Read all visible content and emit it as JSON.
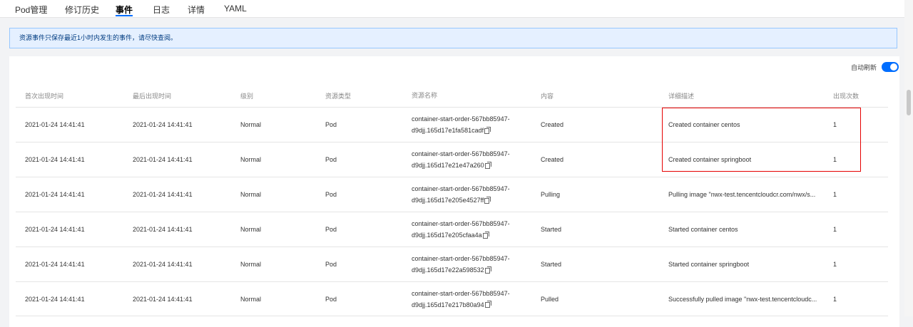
{
  "tabs": [
    {
      "label": "Pod管理"
    },
    {
      "label": "修订历史"
    },
    {
      "label": "事件",
      "active": true
    },
    {
      "label": "日志"
    },
    {
      "label": "详情"
    },
    {
      "label": "YAML"
    }
  ],
  "notice": "资源事件只保存最近1小时内发生的事件，请尽快查阅。",
  "auto_refresh": {
    "label": "自动刷新",
    "enabled": true
  },
  "table": {
    "headers": [
      "首次出现时间",
      "最后出现时间",
      "级别",
      "资源类型",
      "资源名称",
      "内容",
      "详细描述",
      "出现次数"
    ],
    "rows": [
      {
        "first": "2021-01-24 14:41:41",
        "last": "2021-01-24 14:41:41",
        "level": "Normal",
        "type": "Pod",
        "name_line1": "container-start-order-567bb85947-",
        "name_line2": "d9djj.165d17e1fa581cadf",
        "content": "Created",
        "detail": "Created container centos",
        "count": "1"
      },
      {
        "first": "2021-01-24 14:41:41",
        "last": "2021-01-24 14:41:41",
        "level": "Normal",
        "type": "Pod",
        "name_line1": "container-start-order-567bb85947-",
        "name_line2": "d9djj.165d17e21e47a260",
        "content": "Created",
        "detail": "Created container springboot",
        "count": "1"
      },
      {
        "first": "2021-01-24 14:41:41",
        "last": "2021-01-24 14:41:41",
        "level": "Normal",
        "type": "Pod",
        "name_line1": "container-start-order-567bb85947-",
        "name_line2": "d9djj.165d17e205e4527ff",
        "content": "Pulling",
        "detail": "Pulling image \"nwx-test.tencentcloudcr.com/nwx/s...",
        "count": "1"
      },
      {
        "first": "2021-01-24 14:41:41",
        "last": "2021-01-24 14:41:41",
        "level": "Normal",
        "type": "Pod",
        "name_line1": "container-start-order-567bb85947-",
        "name_line2": "d9djj.165d17e205cfaa4a",
        "content": "Started",
        "detail": "Started container centos",
        "count": "1"
      },
      {
        "first": "2021-01-24 14:41:41",
        "last": "2021-01-24 14:41:41",
        "level": "Normal",
        "type": "Pod",
        "name_line1": "container-start-order-567bb85947-",
        "name_line2": "d9djj.165d17e22a598532",
        "content": "Started",
        "detail": "Started container springboot",
        "count": "1"
      },
      {
        "first": "2021-01-24 14:41:41",
        "last": "2021-01-24 14:41:41",
        "level": "Normal",
        "type": "Pod",
        "name_line1": "container-start-order-567bb85947-",
        "name_line2": "d9djj.165d17e217b80a94",
        "content": "Pulled",
        "detail": "Successfully pulled image \"nwx-test.tencentcloudc...",
        "count": "1"
      }
    ]
  },
  "colors": {
    "accent": "#006eff",
    "highlight_border": "#e60000",
    "notice_bg": "#e5f0ff"
  }
}
